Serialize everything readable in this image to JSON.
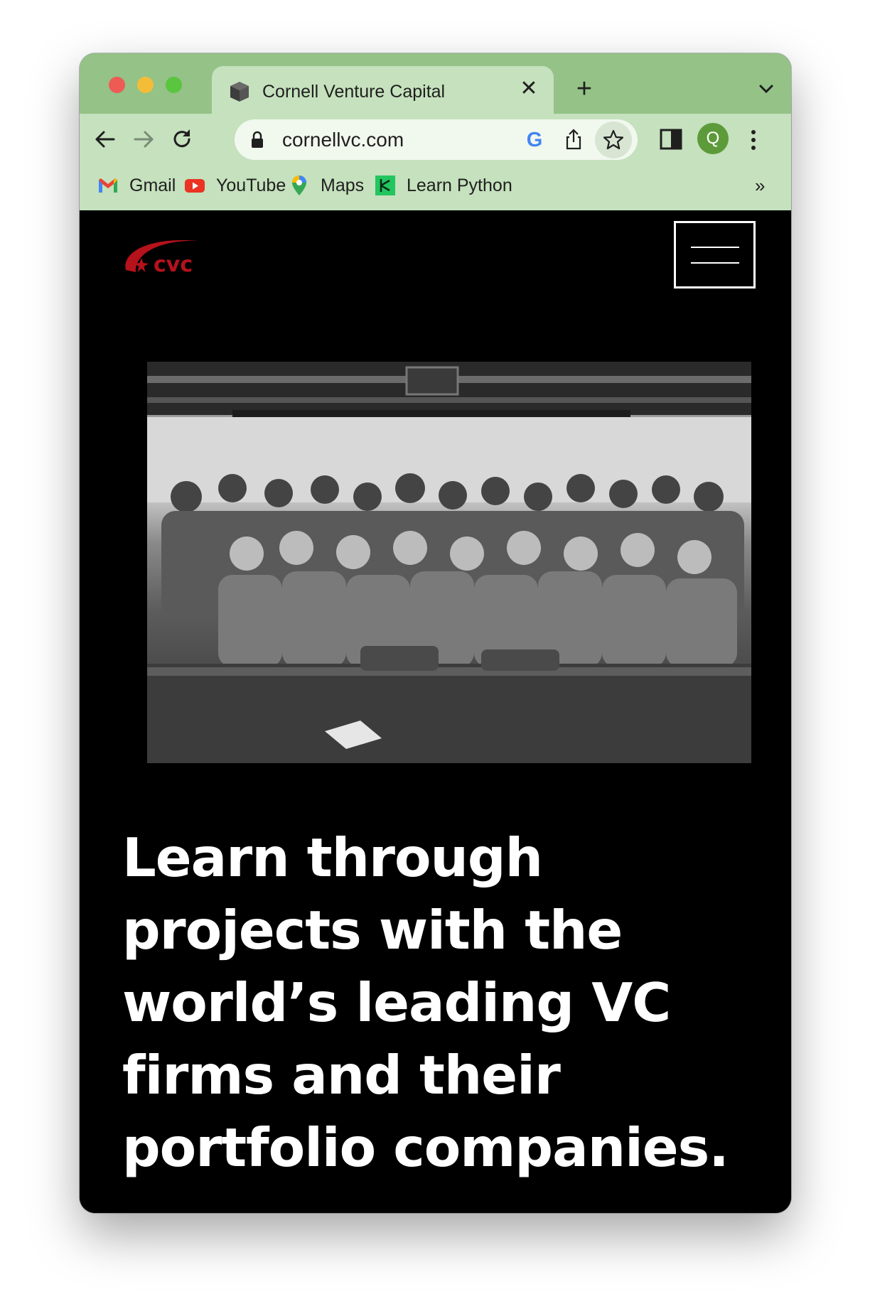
{
  "browser": {
    "tab_title": "Cornell Venture Capital",
    "url": "cornellvc.com",
    "profile_initial": "Q",
    "bookmarks": [
      {
        "label": "Gmail",
        "icon": "gmail-icon"
      },
      {
        "label": "YouTube",
        "icon": "youtube-icon"
      },
      {
        "label": "Maps",
        "icon": "maps-icon"
      },
      {
        "label": "Learn Python",
        "icon": "datacamp-icon"
      }
    ],
    "bookmarks_overflow": "»"
  },
  "site": {
    "logo_text": "cvc",
    "brand_color": "#b5121b",
    "hero_image": "group-photo",
    "headline": "Learn through projects with the world’s leading VC firms and their portfolio companies."
  }
}
